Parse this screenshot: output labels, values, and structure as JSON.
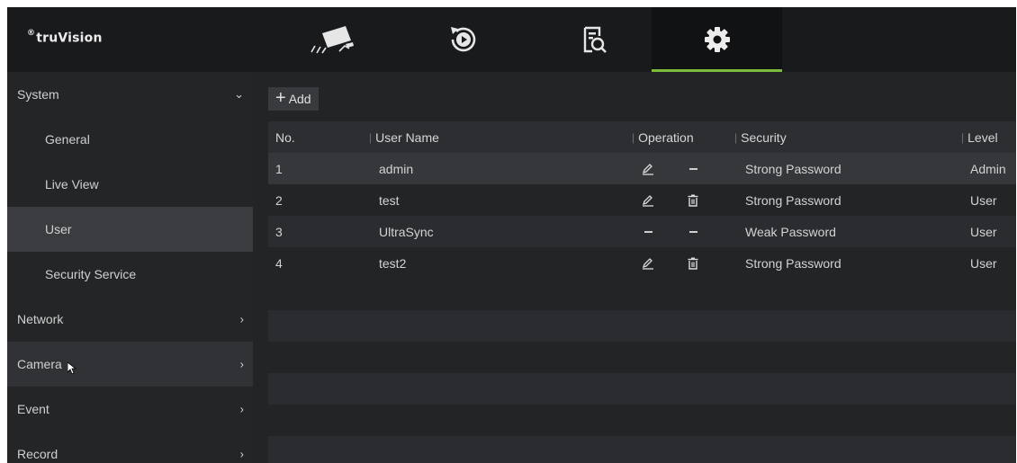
{
  "brand": {
    "logo_mark": "®",
    "logo_text": "truVision"
  },
  "tabs": [
    {
      "name": "live-view",
      "icon": "camera-icon",
      "active": false
    },
    {
      "name": "playback",
      "icon": "playback-icon",
      "active": false
    },
    {
      "name": "search",
      "icon": "search-file-icon",
      "active": false
    },
    {
      "name": "settings",
      "icon": "gear-icon",
      "active": true
    }
  ],
  "sidebar": {
    "system": "System",
    "general": "General",
    "live_view": "Live View",
    "user": "User",
    "security_service": "Security Service",
    "network": "Network",
    "camera": "Camera",
    "event": "Event",
    "record": "Record"
  },
  "add_button": {
    "icon": "+",
    "label": "Add"
  },
  "table": {
    "headers": {
      "no": "No.",
      "user_name": "User Name",
      "operation": "Operation",
      "security": "Security",
      "level": "Level"
    },
    "rows": [
      {
        "no": "1",
        "user_name": "admin",
        "edit": true,
        "delete": false,
        "security": "Strong Password",
        "level": "Admin"
      },
      {
        "no": "2",
        "user_name": "test",
        "edit": true,
        "delete": true,
        "security": "Strong Password",
        "level": "User"
      },
      {
        "no": "3",
        "user_name": "UltraSync",
        "edit": false,
        "delete": false,
        "security": "Weak Password",
        "level": "User"
      },
      {
        "no": "4",
        "user_name": "test2",
        "edit": true,
        "delete": true,
        "security": "Strong Password",
        "level": "User"
      }
    ]
  },
  "colors": {
    "accent": "#7dbb3a",
    "background": "#222426",
    "topbar": "#191a1c"
  }
}
